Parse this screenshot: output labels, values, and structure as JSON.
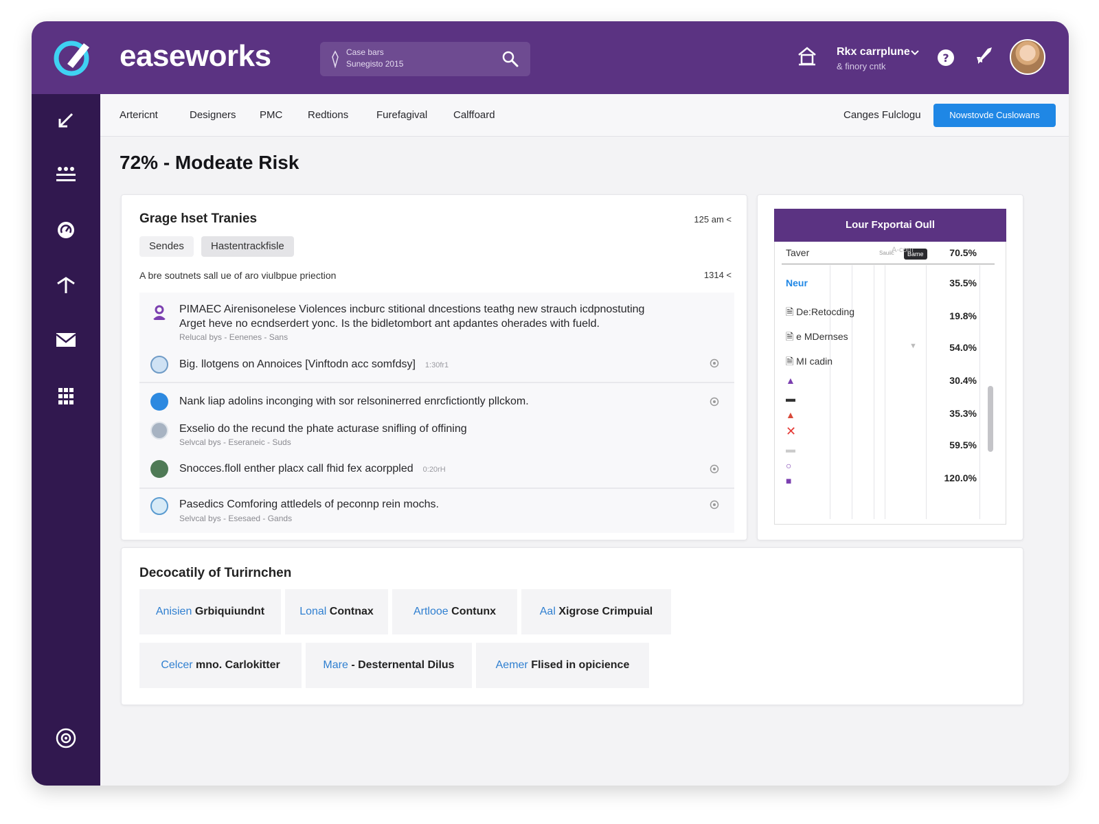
{
  "app": {
    "brand": "easeworks",
    "search_line1": "Case bars",
    "search_line2": "Sunegisto 2015",
    "user_name": "Rkx carrplune",
    "user_sub": "& finory cntk"
  },
  "nav": {
    "tabs": [
      "Artericnt",
      "Designers",
      "PMC",
      "Redtions",
      "Furefagival",
      "Calffoard"
    ],
    "right_link": "Canges Fulclogu",
    "cta": "Nowstovde Cuslowans"
  },
  "page": {
    "title": "72% - Modeate Risk"
  },
  "feed": {
    "title": "Grage hset Tranies",
    "time": "125 am <",
    "chips": [
      "Sendes",
      "Hastentrackfisle"
    ],
    "subtitle": "A bre soutnets sall ue of aro viulbpue priection",
    "subtitle_right": "1314 <",
    "items": [
      {
        "line1": "PIMAEC Airenisonelese Violences incburc stitional dncestions teathg new strauch icdpnostuting",
        "line2": "Arget heve no ecndserdert yonc. Is the bidletombort ant apdantes oherades with fueld.",
        "meta": "Relucal bys - Eenenes - Sans"
      },
      {
        "text": "Big. llotgens on Annoices [Vinftodn acc somfdsy]",
        "stamp": "1:30fr1"
      },
      {
        "text": "Nank liap adolins inconging with sor relsoninerred enrcfictiontly pllckom."
      },
      {
        "text": "Exselio do the recund the phate acturase snifling of offining",
        "meta": "Selvcal bys - Eseraneic - Suds"
      },
      {
        "text": "Snocces.floll enther placx call fhid fex acorppled",
        "stamp": "0:20rH"
      },
      {
        "text": "Pasedics Comforing attledels of peconnp rein mochs.",
        "meta": "Selvcal bys - Esesaed - Gands"
      }
    ]
  },
  "exposure": {
    "title": "Lour Fxportai Oull",
    "small_label": "Sauiic",
    "tooltip": "Bame",
    "header_mark": "A-com",
    "rows": [
      {
        "label": "Taver",
        "value": "70.5%"
      },
      {
        "label": "Neur",
        "value": "35.5%"
      },
      {
        "label": "De:Retocding",
        "value": "19.8%"
      },
      {
        "label": "e MDernses",
        "value": "54.0%"
      },
      {
        "label": "MI cadin",
        "value": "30.4%"
      },
      {
        "label": "",
        "value": "35.3%"
      },
      {
        "label": "",
        "value": "59.5%"
      },
      {
        "label": "",
        "value": "120.0%"
      }
    ]
  },
  "details": {
    "title": "Decocatily of Turirnchen",
    "pills": [
      {
        "key": "Anisien",
        "val": "Grbiquiundnt"
      },
      {
        "key": "Lonal",
        "val": "Contnax"
      },
      {
        "key": "Artlooe",
        "val": "Contunx"
      },
      {
        "key": "Aal",
        "val": "Xigrose Crimpuial"
      },
      {
        "key": "Celcer",
        "val": "mno. Carlokitter"
      },
      {
        "key": "Mare",
        "val": "- Desternental Dilus"
      },
      {
        "key": "Aemer",
        "val": "Flised in opicience"
      }
    ]
  },
  "colors": {
    "header": "#5b3382",
    "sidebar": "#31184f",
    "accent": "#1f87e5",
    "key_text": "#2f7fd0"
  },
  "icons": {
    "sidebar": [
      "edit-icon",
      "menu-icon",
      "dashboard-icon",
      "pin-icon",
      "mail-icon",
      "grid-icon",
      "settings-icon"
    ],
    "header": [
      "logo-icon",
      "search-icon",
      "home-icon",
      "help-icon",
      "rocket-icon"
    ]
  }
}
